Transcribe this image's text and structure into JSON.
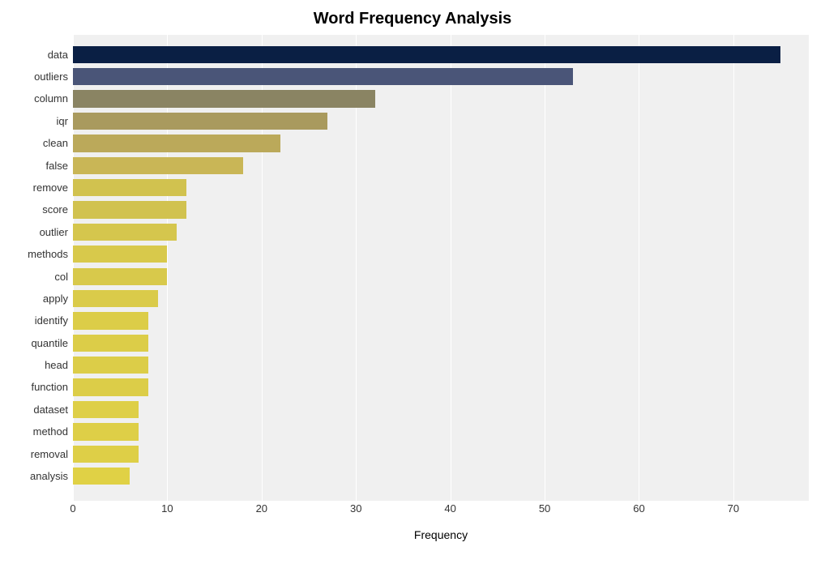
{
  "chart_data": {
    "type": "bar",
    "orientation": "horizontal",
    "title": "Word Frequency Analysis",
    "xlabel": "Frequency",
    "ylabel": "",
    "xlim": [
      0,
      78
    ],
    "x_ticks": [
      0,
      10,
      20,
      30,
      40,
      50,
      60,
      70
    ],
    "categories": [
      "data",
      "outliers",
      "column",
      "iqr",
      "clean",
      "false",
      "remove",
      "score",
      "outlier",
      "methods",
      "col",
      "apply",
      "identify",
      "quantile",
      "head",
      "function",
      "dataset",
      "method",
      "removal",
      "analysis"
    ],
    "values": [
      75,
      53,
      32,
      27,
      22,
      18,
      12,
      12,
      11,
      10,
      10,
      9,
      8,
      8,
      8,
      8,
      7,
      7,
      7,
      6
    ],
    "colors": [
      "#0a1f44",
      "#4a5578",
      "#8a8463",
      "#a99a5e",
      "#bba95a",
      "#c9b656",
      "#d1c24f",
      "#d1c24f",
      "#d5c64d",
      "#d8c94b",
      "#d8c94b",
      "#dacb4a",
      "#dccd48",
      "#dccd48",
      "#dccd48",
      "#dccd48",
      "#decf47",
      "#decf47",
      "#decf47",
      "#e0d145"
    ]
  }
}
